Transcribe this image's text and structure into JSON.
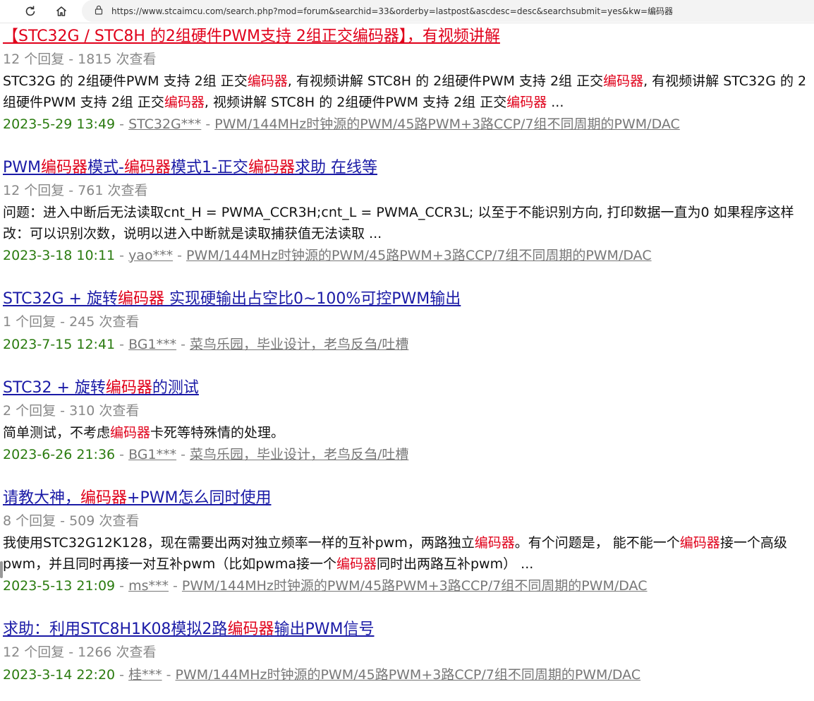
{
  "browser": {
    "url": "https://www.stcaimcu.com/search.php?mod=forum&searchid=33&orderby=lastpost&ascdesc=desc&searchsubmit=yes&kw=编码器"
  },
  "results": [
    {
      "title_parts": [
        "【STC32G / STC8H 的2组硬件PWM支持 2组正交编码器】，有视频讲解"
      ],
      "title_color": "#e0001a",
      "meta": "12 个回复 - 1815 次查看",
      "snippet_parts": [
        "STC32G 的 2组硬件PWM 支持 2组 正交",
        "编码器",
        ", 有视频讲解 STC8H 的 2组硬件PWM 支持 2组 正交",
        "编码器",
        ", 有视频讲解 STC32G 的 2组硬件PWM 支持 2组 正交",
        "编码器",
        ", 视频讲解 STC8H 的 2组硬件PWM 支持 2组 正交",
        "编码器",
        " ..."
      ],
      "date": "2023-5-29 13:49",
      "author": "STC32G***",
      "forum": "PWM/144MHz时钟源的PWM/45路PWM+3路CCP/7组不同周期的PWM/DAC"
    },
    {
      "title_parts": [
        "PWM",
        "编码器",
        "模式-",
        "编码器",
        "模式1-正交",
        "编码器",
        "求助 在线等"
      ],
      "title_color": "#1a1aa6",
      "meta": "12 个回复 - 761 次查看",
      "snippet_parts": [
        "问题：进入中断后无法读取cnt_H = PWMA_CCR3H;cnt_L = PWMA_CCR3L; 以至于不能识别方向, 打印数据一直为0 如果程序这样改：可以识别次数，说明以进入中断就是读取捕获值无法读取 ..."
      ],
      "date": "2023-3-18 10:11",
      "author": "yao***",
      "forum": "PWM/144MHz时钟源的PWM/45路PWM+3路CCP/7组不同周期的PWM/DAC"
    },
    {
      "title_parts": [
        "STC32G + 旋转",
        "编码器",
        " 实现硬输出占空比0~100%可控PWM输出"
      ],
      "title_color": "#1a1aa6",
      "meta": "1 个回复 - 245 次查看",
      "snippet_parts": [],
      "date": "2023-7-15 12:41",
      "author": "BG1***",
      "forum": "菜鸟乐园，毕业设计，老鸟反刍/吐槽"
    },
    {
      "title_parts": [
        "STC32 + 旋转",
        "编码器",
        "的测试"
      ],
      "title_color": "#1a1aa6",
      "meta": "2 个回复 - 310 次查看",
      "snippet_parts": [
        "简单测试，不考虑",
        "编码器",
        "卡死等特殊情的处理。"
      ],
      "date": "2023-6-26 21:36",
      "author": "BG1***",
      "forum": "菜鸟乐园，毕业设计，老鸟反刍/吐槽"
    },
    {
      "title_parts": [
        "请教大神，",
        "编码器",
        "+PWM怎么同时使用"
      ],
      "title_color": "#1a1aa6",
      "meta": "8 个回复 - 509 次查看",
      "snippet_parts": [
        "我使用STC32G12K128，现在需要出两对独立频率一样的互补pwm，两路独立",
        "编码器",
        "。有个问题是， 能不能一个",
        "编码器",
        "接一个高级pwm，并且同时再接一对互补pwm（比如pwma接一个",
        "编码器",
        "同时出两路互补pwm） ..."
      ],
      "date": "2023-5-13 21:09",
      "author": "ms***",
      "forum": "PWM/144MHz时钟源的PWM/45路PWM+3路CCP/7组不同周期的PWM/DAC"
    },
    {
      "title_parts": [
        "求助：利用STC8H1K08模拟2路",
        "编码器",
        "输出PWM信号"
      ],
      "title_color": "#1a1aa6",
      "meta": "12 个回复 - 1266 次查看",
      "snippet_parts": [],
      "date": "2023-3-14 22:20",
      "author": "桂***",
      "forum": "PWM/144MHz时钟源的PWM/45路PWM+3路CCP/7组不同周期的PWM/DAC"
    }
  ]
}
